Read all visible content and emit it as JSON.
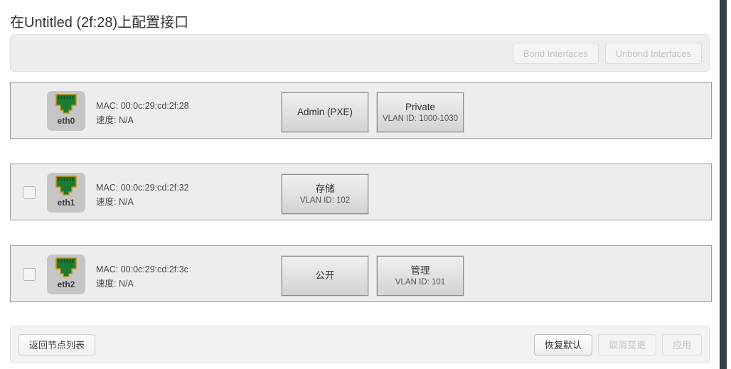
{
  "page": {
    "title": "在Untitled (2f:28)上配置接口"
  },
  "toolbar": {
    "buttons": [
      {
        "label": "Bond Interfaces",
        "name": "bond-interfaces-button",
        "disabled": true
      },
      {
        "label": "Unbond Interfaces",
        "name": "unbond-interfaces-button",
        "disabled": true
      }
    ]
  },
  "interfaces": [
    {
      "name": "eth0",
      "has_checkbox": false,
      "checked": false,
      "mac_line": "MAC: 00:0c:29:cd:2f:28",
      "speed_line": "速度: N/A",
      "tags": [
        {
          "name": "Admin (PXE)",
          "vlan": ""
        },
        {
          "name": "Private",
          "vlan": "VLAN ID: 1000-1030"
        }
      ]
    },
    {
      "name": "eth1",
      "has_checkbox": true,
      "checked": false,
      "mac_line": "MAC: 00:0c:29:cd:2f:32",
      "speed_line": "速度: N/A",
      "tags": [
        {
          "name": "存储",
          "vlan": "VLAN ID: 102"
        }
      ]
    },
    {
      "name": "eth2",
      "has_checkbox": true,
      "checked": false,
      "mac_line": "MAC: 00:0c:29:cd:2f:3c",
      "speed_line": "速度: N/A",
      "tags": [
        {
          "name": "公开",
          "vlan": ""
        },
        {
          "name": "管理",
          "vlan": "VLAN ID: 101"
        }
      ]
    }
  ],
  "footer": {
    "back_label": "返回节点列表",
    "buttons": [
      {
        "label": "恢复默认",
        "name": "restore-defaults-button",
        "disabled": false
      },
      {
        "label": "取消变更",
        "name": "cancel-changes-button",
        "disabled": true
      },
      {
        "label": "应用",
        "name": "apply-button",
        "disabled": true
      }
    ]
  },
  "icons": {
    "nic": "ethernet-port-icon"
  },
  "colors": {
    "nic_green": "#1d7a32",
    "nic_green_dark": "#0f5a22",
    "nic_gold": "#b9941f",
    "panel_bg": "#ededed",
    "edge_bar": "#333e48"
  }
}
